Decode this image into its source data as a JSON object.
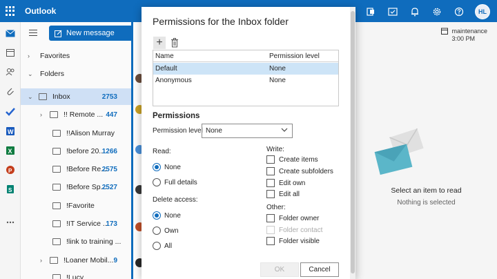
{
  "app": {
    "title": "Outlook"
  },
  "user": {
    "initials": "HL"
  },
  "toolbar": {
    "new_mail_label": "New message"
  },
  "folders": {
    "favorites_label": "Favorites",
    "folders_label": "Folders",
    "inbox": {
      "label": "Inbox",
      "count": "2753"
    },
    "items": [
      {
        "label": "!! Remote ...",
        "count": "447",
        "expandable": true
      },
      {
        "label": "!!Alison Murray",
        "count": "",
        "expandable": false
      },
      {
        "label": "!before 20...",
        "count": "1266",
        "expandable": false
      },
      {
        "label": "!Before Re...",
        "count": "2575",
        "expandable": false
      },
      {
        "label": "!Before Sp...",
        "count": "2527",
        "expandable": false
      },
      {
        "label": "!Favorite",
        "count": "",
        "expandable": false
      },
      {
        "label": "!IT Service ...",
        "count": "173",
        "expandable": false
      },
      {
        "label": "!link to training ...",
        "count": "",
        "expandable": false
      },
      {
        "label": "!Loaner Mobil...",
        "count": "9",
        "expandable": true
      },
      {
        "label": "!Lucy",
        "count": "",
        "expandable": false
      }
    ]
  },
  "reading_pane": {
    "calendar_title": "maintenance",
    "calendar_time": "3:00 PM",
    "empty_title": "Select an item to read",
    "empty_subtitle": "Nothing is selected"
  },
  "dialog": {
    "title": "Permissions for the Inbox folder",
    "table": {
      "col_name": "Name",
      "col_level": "Permission level",
      "rows": [
        {
          "name": "Default",
          "level": "None",
          "selected": true
        },
        {
          "name": "Anonymous",
          "level": "None",
          "selected": false
        }
      ]
    },
    "permissions_title": "Permissions",
    "permission_level_label": "Permission level",
    "permission_level_value": "None",
    "read_label": "Read:",
    "read_options": [
      {
        "label": "None",
        "checked": true
      },
      {
        "label": "Full details",
        "checked": false
      }
    ],
    "delete_label": "Delete access:",
    "delete_options": [
      {
        "label": "None",
        "checked": true
      },
      {
        "label": "Own",
        "checked": false
      },
      {
        "label": "All",
        "checked": false
      }
    ],
    "write_label": "Write:",
    "write_options": [
      {
        "label": "Create items",
        "checked": false,
        "disabled": false
      },
      {
        "label": "Create subfolders",
        "checked": false,
        "disabled": false
      },
      {
        "label": "Edit own",
        "checked": false,
        "disabled": false
      },
      {
        "label": "Edit all",
        "checked": false,
        "disabled": false
      }
    ],
    "other_label": "Other:",
    "other_options": [
      {
        "label": "Folder owner",
        "checked": false,
        "disabled": false
      },
      {
        "label": "Folder contact",
        "checked": false,
        "disabled": true
      },
      {
        "label": "Folder visible",
        "checked": false,
        "disabled": false
      }
    ],
    "ok_label": "OK",
    "cancel_label": "Cancel"
  },
  "colors": {
    "brand": "#0f6cbd",
    "selection": "#cde4f7"
  }
}
